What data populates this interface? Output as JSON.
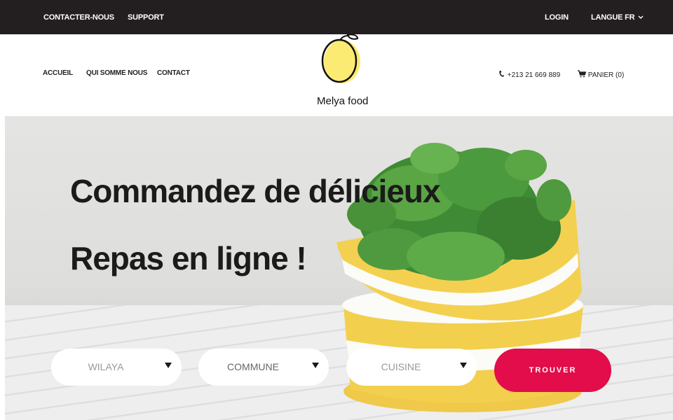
{
  "topbar": {
    "contact": "CONTACTER-NOUS",
    "support": "SUPPORT",
    "login": "LOGIN",
    "language": "LANGUE FR"
  },
  "nav": {
    "home": "ACCUEIL",
    "about": "QUI SOMME NOUS",
    "contact": "CONTACT",
    "phone": "+213 21 669 889",
    "cart": "PANIER (0)"
  },
  "brand": {
    "name": "Melya food"
  },
  "hero": {
    "line1": "Commandez de délicieux",
    "line2": "Repas en ligne !"
  },
  "search": {
    "wilaya": "WILAYA",
    "commune": "COMMUNE",
    "cuisine": "CUISINE",
    "submit": "TROUVER"
  },
  "colors": {
    "accent": "#e20d4a",
    "topbar": "#231f20",
    "logo_fill": "#fbeb73"
  },
  "icons": {
    "phone": "phone-icon",
    "cart": "cart-icon",
    "dropdown": "chevron-down-icon"
  }
}
